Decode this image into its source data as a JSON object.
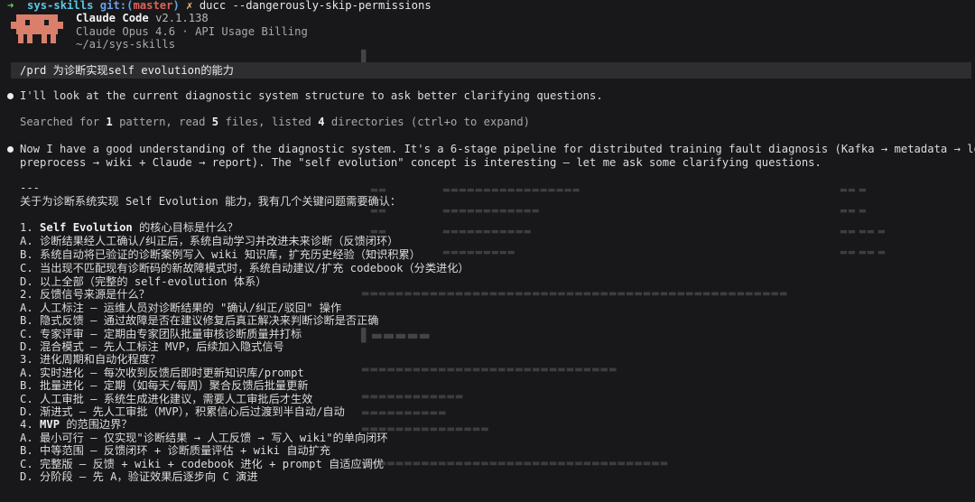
{
  "terminal": {
    "prompt_arrow": "➜",
    "dir": "sys-skills",
    "git_label": "git:(",
    "branch": "master",
    "git_close": ")",
    "dirty_mark": "✗",
    "command": "ducc --dangerously-skip-permissions"
  },
  "banner": {
    "app_name": "Claude Code",
    "version": "v2.1.138",
    "model_line": "Claude Opus 4.6 · API Usage Billing",
    "path": "~/ai/sys-skills"
  },
  "user_message": "/prd 为诊断实现self evolution的能力",
  "assistant": {
    "msg1": "I'll look at the current diagnostic system structure to ask better clarifying questions.",
    "search_prefix": "Searched for ",
    "search_n1": "1",
    "search_mid1": " pattern, read ",
    "search_n2": "5",
    "search_mid2": " files, listed ",
    "search_n3": "4",
    "search_suffix": " directories (ctrl+o to expand)",
    "msg2_line1": "Now I have a good understanding of the diagnostic system. It's a 6-stage pipeline for distributed training fault diagnosis (Kafka → metadata → logs →",
    "msg2_line2": "preprocess → wiki + Claude → report). The \"self evolution\" concept is interesting — let me ask some clarifying questions.",
    "separator": "---",
    "intro": "关于为诊断系统实现 Self Evolution 能力，我有几个关键问题需要确认：",
    "questions": [
      {
        "num": "1. ",
        "bold": "Self Evolution",
        "rest": " 的核心目标是什么？",
        "options": [
          "A. 诊断结果经人工确认/纠正后，系统自动学习并改进未来诊断（反馈闭环）",
          "B. 系统自动将已验证的诊断案例写入 wiki 知识库，扩充历史经验（知识积累）",
          "C. 当出现不匹配现有诊断码的新故障模式时，系统自动建议/扩充 codebook（分类进化）",
          "D. 以上全部（完整的 self-evolution 体系）"
        ]
      },
      {
        "num": "2. ",
        "bold": "",
        "rest": "反馈信号来源是什么？",
        "options": [
          "A. 人工标注 — 运维人员对诊断结果的 \"确认/纠正/驳回\" 操作",
          "B. 隐式反馈 — 通过故障是否在建议修复后真正解决来判断诊断是否正确",
          "C. 专家评审 — 定期由专家团队批量审核诊断质量并打标",
          "D. 混合模式 — 先人工标注 MVP，后续加入隐式信号"
        ]
      },
      {
        "num": "3. ",
        "bold": "",
        "rest": "进化周期和自动化程度？",
        "options": [
          "A. 实时进化 — 每次收到反馈后即时更新知识库/prompt",
          "B. 批量进化 — 定期（如每天/每周）聚合反馈后批量更新",
          "C. 人工审批 — 系统生成进化建议，需要人工审批后才生效",
          "D. 渐进式 — 先人工审批（MVP），积累信心后过渡到半自动/自动"
        ]
      },
      {
        "num": "4. ",
        "bold": "MVP",
        "rest": " 的范围边界？",
        "options": [
          "A. 最小可行 — 仅实现\"诊断结果 → 人工反馈 → 写入 wiki\"的单向闭环",
          "B. 中等范围 — 反馈闭环 + 诊断质量评估 + wiki 自动扩充",
          "C. 完整版 — 反馈 + wiki + codebook 进化 + prompt 自适应调优",
          "D. 分阶段 — 先 A，验证效果后逐步向 C 演进"
        ]
      }
    ]
  },
  "colors": {
    "green": "#5fd75f",
    "cyan": "#5ac8e8",
    "red": "#e0605a",
    "yellow": "#e5c07b",
    "mascot": "#d97f6b",
    "background": "#18181a"
  }
}
